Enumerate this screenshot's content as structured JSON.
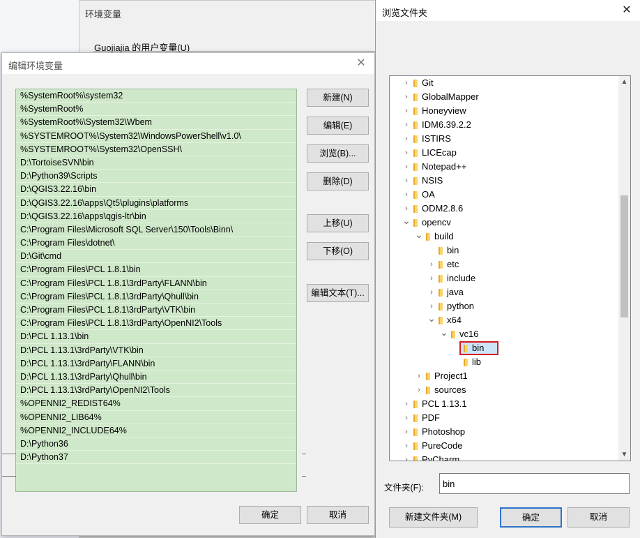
{
  "env_window": {
    "title": "环境变量",
    "user_vars_label": "Guojiajia 的用户变量(U)"
  },
  "edit_dialog": {
    "title": "编辑环境变量",
    "close_glyph": "✕",
    "paths": [
      "%SystemRoot%\\system32",
      "%SystemRoot%",
      "%SystemRoot%\\System32\\Wbem",
      "%SYSTEMROOT%\\System32\\WindowsPowerShell\\v1.0\\",
      "%SYSTEMROOT%\\System32\\OpenSSH\\",
      "D:\\TortoiseSVN\\bin",
      "D:\\Python39\\Scripts",
      "D:\\QGIS3.22.16\\bin",
      "D:\\QGIS3.22.16\\apps\\Qt5\\plugins\\platforms",
      "D:\\QGIS3.22.16\\apps\\qgis-ltr\\bin",
      "C:\\Program Files\\Microsoft SQL Server\\150\\Tools\\Binn\\",
      "C:\\Program Files\\dotnet\\",
      "D:\\Git\\cmd",
      "C:\\Program Files\\PCL 1.8.1\\bin",
      "C:\\Program Files\\PCL 1.8.1\\3rdParty\\FLANN\\bin",
      "C:\\Program Files\\PCL 1.8.1\\3rdParty\\Qhull\\bin",
      "C:\\Program Files\\PCL 1.8.1\\3rdParty\\VTK\\bin",
      "C:\\Program Files\\PCL 1.8.1\\3rdParty\\OpenNI2\\Tools",
      "D:\\PCL 1.13.1\\bin",
      "D:\\PCL 1.13.1\\3rdParty\\VTK\\bin",
      "D:\\PCL 1.13.1\\3rdParty\\FLANN\\bin",
      "D:\\PCL 1.13.1\\3rdParty\\Qhull\\bin",
      "D:\\PCL 1.13.1\\3rdParty\\OpenNI2\\Tools",
      "%OPENNI2_REDIST64%",
      "%OPENNI2_LIB64%",
      "%OPENNI2_INCLUDE64%",
      "D:\\Python36",
      "D:\\Python37"
    ],
    "buttons": {
      "new": "新建(N)",
      "edit": "编辑(E)",
      "browse": "浏览(B)...",
      "delete": "删除(D)",
      "move_up": "上移(U)",
      "move_down": "下移(O)",
      "edit_text": "编辑文本(T)...",
      "ok": "确定",
      "cancel": "取消"
    }
  },
  "browse_dialog": {
    "title": "浏览文件夹",
    "close_glyph": "✕",
    "tree": [
      {
        "label": "Git",
        "depth": 0,
        "state": "collapsed"
      },
      {
        "label": "GlobalMapper",
        "depth": 0,
        "state": "collapsed"
      },
      {
        "label": "Honeyview",
        "depth": 0,
        "state": "collapsed"
      },
      {
        "label": "IDM6.39.2.2",
        "depth": 0,
        "state": "collapsed"
      },
      {
        "label": "ISTIRS",
        "depth": 0,
        "state": "collapsed"
      },
      {
        "label": "LICEcap",
        "depth": 0,
        "state": "collapsed"
      },
      {
        "label": "Notepad++",
        "depth": 0,
        "state": "collapsed"
      },
      {
        "label": "NSIS",
        "depth": 0,
        "state": "collapsed"
      },
      {
        "label": "OA",
        "depth": 0,
        "state": "collapsed"
      },
      {
        "label": "ODM2.8.6",
        "depth": 0,
        "state": "collapsed"
      },
      {
        "label": "opencv",
        "depth": 0,
        "state": "expanded"
      },
      {
        "label": "build",
        "depth": 1,
        "state": "expanded"
      },
      {
        "label": "bin",
        "depth": 2,
        "state": "leaf"
      },
      {
        "label": "etc",
        "depth": 2,
        "state": "collapsed"
      },
      {
        "label": "include",
        "depth": 2,
        "state": "collapsed"
      },
      {
        "label": "java",
        "depth": 2,
        "state": "collapsed"
      },
      {
        "label": "python",
        "depth": 2,
        "state": "collapsed"
      },
      {
        "label": "x64",
        "depth": 2,
        "state": "expanded"
      },
      {
        "label": "vc16",
        "depth": 3,
        "state": "expanded"
      },
      {
        "label": "bin",
        "depth": 4,
        "state": "selected"
      },
      {
        "label": "lib",
        "depth": 4,
        "state": "leaf"
      },
      {
        "label": "Project1",
        "depth": 1,
        "state": "collapsed"
      },
      {
        "label": "sources",
        "depth": 1,
        "state": "collapsed"
      },
      {
        "label": "PCL 1.13.1",
        "depth": 0,
        "state": "collapsed"
      },
      {
        "label": "PDF",
        "depth": 0,
        "state": "collapsed"
      },
      {
        "label": "Photoshop",
        "depth": 0,
        "state": "collapsed"
      },
      {
        "label": "PureCode",
        "depth": 0,
        "state": "collapsed"
      },
      {
        "label": "PyCharm",
        "depth": 0,
        "state": "collapsed"
      }
    ],
    "folder_label": "文件夹(F):",
    "folder_value": "bin",
    "buttons": {
      "new_folder": "新建文件夹(M)",
      "ok": "确定",
      "cancel": "取消"
    }
  }
}
